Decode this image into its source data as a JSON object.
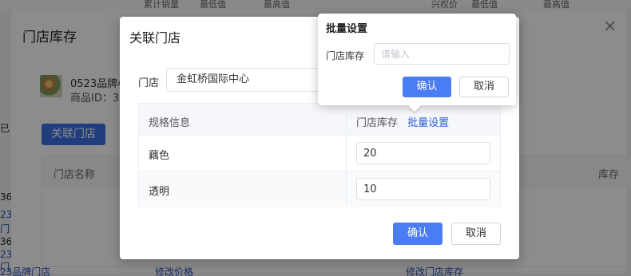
{
  "background": {
    "header_strip": [
      "累计销量",
      "最低值",
      "最高值",
      "兴权价",
      "最低值",
      "最高值"
    ],
    "outer_modal": {
      "title": "门店库存",
      "close_glyph": "×",
      "product_name": "0523品牌小",
      "product_id": "商品ID：36",
      "link_store_button": "关联门店",
      "table_headers": {
        "store_name": "门店名称",
        "stock": "库存"
      }
    },
    "left_stubs": [
      "已",
      "36",
      "23",
      "门",
      "36",
      "23",
      "门"
    ],
    "bottom_row": [
      "23品牌门店",
      "修改价格",
      "修改门店库存"
    ]
  },
  "dialog": {
    "title": "关联门店",
    "store_label": "门店",
    "store_value": "金虹桥国际中心",
    "table": {
      "header_spec": "规格信息",
      "header_stock": "门店库存",
      "header_batch": "批量设置",
      "rows": [
        {
          "spec": "藕色",
          "stock": "20"
        },
        {
          "spec": "透明",
          "stock": "10"
        }
      ]
    },
    "confirm": "确认",
    "cancel": "取消"
  },
  "popover": {
    "title": "批量设置",
    "label": "门店库存",
    "placeholder": "请输入",
    "value": "",
    "confirm": "确认",
    "cancel": "取消"
  },
  "colors": {
    "primary": "#4a7cf3",
    "link": "#2f5fd8",
    "overlay": "rgba(0,0,0,0.45)"
  }
}
